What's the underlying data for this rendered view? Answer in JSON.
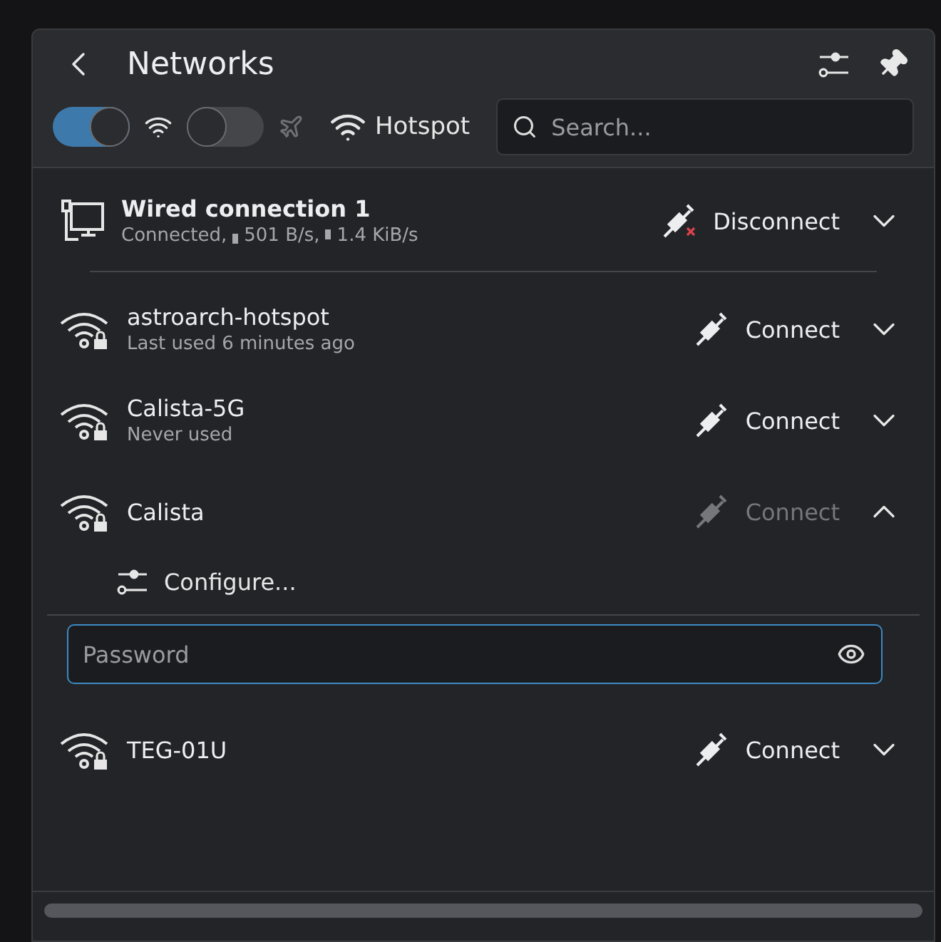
{
  "header": {
    "title": "Networks"
  },
  "toolbar": {
    "wifi_toggle": {
      "on": true
    },
    "airplane_toggle": {
      "on": false
    },
    "hotspot": "Hotspot",
    "search": {
      "placeholder": "Search..."
    }
  },
  "wired": {
    "name": "Wired connection 1",
    "status": "Connected,",
    "download": "501 B/s,",
    "upload": "1.4 KiB/s",
    "action": "Disconnect",
    "expanded": false
  },
  "networks": [
    {
      "name": "astroarch-hotspot",
      "detail": "Last used 6 minutes ago",
      "action": "Connect",
      "action_disabled": false,
      "expanded": false
    },
    {
      "name": "Calista-5G",
      "detail": "Never used",
      "action": "Connect",
      "action_disabled": false,
      "expanded": false
    },
    {
      "name": "Calista",
      "action": "Connect",
      "action_disabled": true,
      "expanded": true,
      "configure": "Configure...",
      "password": {
        "placeholder": "Password"
      }
    },
    {
      "name": "TEG-01U",
      "action": "Connect",
      "action_disabled": false,
      "expanded": false
    }
  ]
}
